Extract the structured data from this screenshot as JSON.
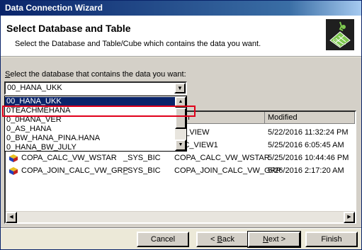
{
  "window": {
    "title": "Data Connection Wizard"
  },
  "header": {
    "title": "Select Database and Table",
    "description": "Select the Database and Table/Cube which contains the data you want.",
    "icon": "wizard-icon"
  },
  "database": {
    "label_accel": "S",
    "label_rest": "elect the database that contains the data you want:",
    "selected": "00_HANA_UKK",
    "options": [
      "00_HANA_UKK",
      "0TEACHMEHANA",
      "0_0HANA_VER",
      "0_AS_HANA",
      "0_BW_HANA_PINA.HANA",
      "0_HANA_BW_JULY"
    ],
    "selected_index": 0,
    "highlighted_index": 1
  },
  "table": {
    "columns": [
      "tion",
      "Modified"
    ],
    "rows": [
      {
        "c1": "",
        "c2": "",
        "c3": "NA_VIEW",
        "modified": "5/22/2016 11:32:24 PM"
      },
      {
        "c1": "",
        "c2": "",
        "c3": "ALC_VIEW1",
        "modified": "5/25/2016 6:05:45 AM"
      },
      {
        "c1": "COPA_CALC_VW_WSTAR",
        "c2": "_SYS_BIC",
        "c3": "COPA_CALC_VW_WSTAR",
        "modified": "5/25/2016 10:44:46 PM"
      },
      {
        "c1": "COPA_JOIN_CALC_VW_GRP",
        "c2": "_SYS_BIC",
        "c3": "COPA_JOIN_CALC_VW_GRP",
        "modified": "5/26/2016 2:17:20 AM"
      }
    ]
  },
  "buttons": {
    "cancel": "Cancel",
    "back_accel": "B",
    "back_prefix": "< ",
    "back_rest": "ack",
    "next_accel": "N",
    "next_rest": "ext >",
    "finish": "Finish"
  },
  "colors": {
    "title_bar": "#0a246a",
    "selection": "#0a246a",
    "highlight_box": "#e0001b",
    "face": "#d4d0c8"
  }
}
